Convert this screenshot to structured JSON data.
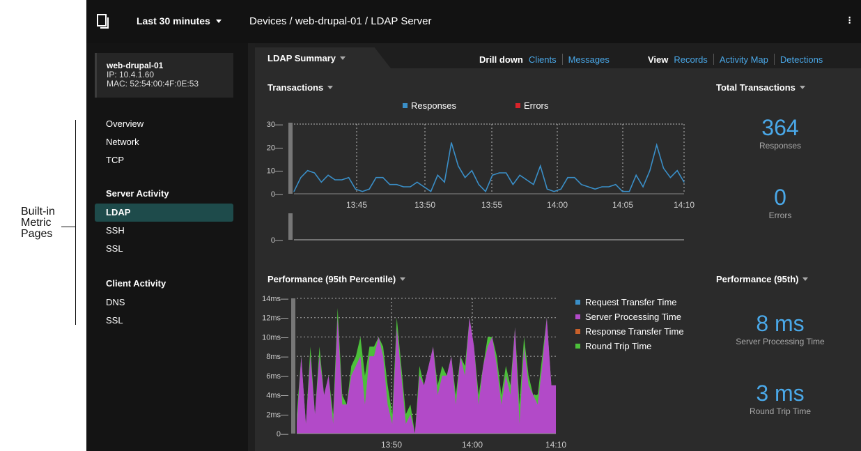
{
  "annotation": {
    "lines": [
      "Built-in",
      "Metric",
      "Pages"
    ]
  },
  "topbar": {
    "time_range": "Last 30 minutes",
    "breadcrumb": "Devices / web-drupal-01 / LDAP Server",
    "menu_glyph": "⁝"
  },
  "device": {
    "name": "web-drupal-01",
    "ip": "IP: 10.4.1.60",
    "mac": "MAC: 52:54:00:4F:0E:53"
  },
  "sidebar": {
    "protocol_items": [
      "Overview",
      "Network",
      "TCP"
    ],
    "server_header": "Server Activity",
    "server_items": [
      "LDAP",
      "SSH",
      "SSL"
    ],
    "client_header": "Client Activity",
    "client_items": [
      "DNS",
      "SSL"
    ]
  },
  "tabs": {
    "summary": "LDAP Summary",
    "drill_label": "Drill down",
    "drill_links": [
      "Clients",
      "Messages"
    ],
    "view_label": "View",
    "view_links": [
      "Records",
      "Activity Map",
      "Detections"
    ]
  },
  "transactions": {
    "title": "Transactions",
    "legend": [
      "Responses",
      "Errors"
    ],
    "total_title": "Total Transactions",
    "responses_value": "364",
    "responses_label": "Responses",
    "errors_value": "0",
    "errors_label": "Errors"
  },
  "performance": {
    "title": "Performance (95th Percentile)",
    "legend": [
      "Request Transfer Time",
      "Server Processing Time",
      "Response Transfer Time",
      "Round Trip Time"
    ],
    "total_title": "Performance (95th)",
    "spt_value": "8 ms",
    "spt_label": "Server Processing Time",
    "rtt_value": "3 ms",
    "rtt_label": "Round Trip Time"
  },
  "colors": {
    "accent": "#4aa8e8",
    "responses": "#3a8fc8",
    "errors": "#d8232a",
    "request_transfer": "#3a8fc8",
    "server_processing": "#b24ac8",
    "response_transfer": "#c8602a",
    "round_trip": "#4cc03a",
    "active_nav": "#1e4b4b"
  },
  "chart_data": [
    {
      "type": "line",
      "title": "Transactions",
      "series": [
        {
          "name": "Responses",
          "values": [
            1,
            7,
            10,
            9,
            5,
            8,
            6,
            6,
            7,
            2,
            1,
            2,
            7,
            7,
            4,
            4,
            3,
            3,
            5,
            3,
            1,
            8,
            5,
            22,
            12,
            7,
            10,
            4,
            1,
            8,
            9,
            9,
            4,
            8,
            6,
            4,
            12,
            2,
            1,
            2,
            7,
            7,
            4,
            3,
            2,
            3,
            3,
            4,
            1,
            1,
            8,
            3,
            10,
            21,
            11,
            7,
            10,
            5
          ]
        }
      ],
      "x_ticks": [
        "13:45",
        "13:50",
        "13:55",
        "14:00",
        "14:05",
        "14:10"
      ],
      "y_ticks": [
        "0",
        "10",
        "20",
        "30"
      ],
      "ylim": [
        0,
        30
      ]
    },
    {
      "type": "bar",
      "title": "Errors",
      "series": [
        {
          "name": "Errors",
          "values": []
        }
      ],
      "y_ticks": [
        "0"
      ]
    },
    {
      "type": "area",
      "title": "Performance (95th Percentile)",
      "series": [
        {
          "name": "Server Processing Time",
          "values": [
            1,
            8,
            1,
            8,
            2,
            8,
            4,
            6,
            1,
            12,
            3,
            3,
            6,
            7,
            8,
            3,
            8,
            8,
            10,
            8,
            3,
            1,
            11,
            6,
            1,
            2,
            0,
            6,
            5,
            7,
            9,
            4,
            6,
            6,
            8,
            3,
            8,
            6,
            12,
            9,
            3,
            7,
            9,
            10,
            7,
            3,
            6,
            4,
            11,
            1,
            9,
            5,
            4,
            3,
            7,
            12,
            5,
            5
          ]
        },
        {
          "name": "Round Trip Time",
          "values": [
            2,
            8,
            1,
            9,
            2,
            9,
            4,
            6,
            2,
            13,
            4,
            3,
            7,
            8,
            10,
            6,
            9,
            9,
            10,
            9,
            5,
            2,
            12,
            7,
            2,
            3,
            0,
            7,
            5,
            7,
            9,
            5,
            7,
            6,
            8,
            4,
            8,
            7,
            12,
            9,
            4,
            7,
            10,
            10,
            8,
            4,
            7,
            5,
            11,
            3,
            10,
            6,
            4,
            4,
            8,
            12,
            5,
            5
          ]
        },
        {
          "name": "Request Transfer Time",
          "values": []
        },
        {
          "name": "Response Transfer Time",
          "values": []
        }
      ],
      "x_ticks": [
        "13:50",
        "14:00",
        "14:10"
      ],
      "y_ticks": [
        "0",
        "2ms",
        "4ms",
        "6ms",
        "8ms",
        "10ms",
        "12ms",
        "14ms"
      ],
      "ylim": [
        0,
        14
      ]
    }
  ]
}
